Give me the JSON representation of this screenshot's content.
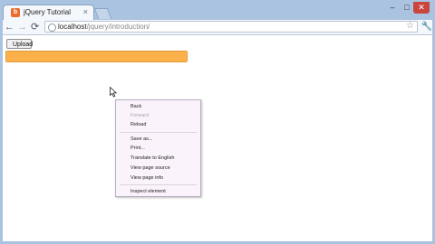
{
  "browser": {
    "tab_title": "jQuery Tutorial",
    "favicon_letter": "b",
    "close_glyph": "×",
    "window": {
      "minimize": "–",
      "maximize": "□",
      "close": "✕"
    },
    "nav": {
      "back": "←",
      "forward": "→",
      "reload": "⟳"
    },
    "address": {
      "host": "localhost",
      "path": "/jquery/introduction/"
    },
    "star_glyph": "☆",
    "wrench_glyph": "🔧"
  },
  "page": {
    "upload_label": "Upload",
    "progress_fraction": 1.0,
    "accent_color": "#fbb04a"
  },
  "context_menu": {
    "items": [
      {
        "label": "Back",
        "enabled": true
      },
      {
        "label": "Forward",
        "enabled": false
      },
      {
        "label": "Reload",
        "enabled": true
      },
      {
        "label": "Save as...",
        "enabled": true
      },
      {
        "label": "Print...",
        "enabled": true
      },
      {
        "label": "Translate to English",
        "enabled": true
      },
      {
        "label": "View page source",
        "enabled": true
      },
      {
        "label": "View page info",
        "enabled": true
      },
      {
        "label": "Inspect element",
        "enabled": true
      }
    ]
  }
}
